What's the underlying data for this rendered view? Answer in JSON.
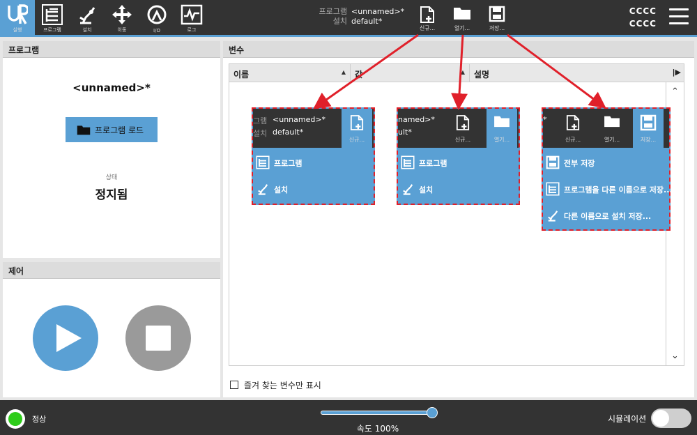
{
  "nav": {
    "run": "실행",
    "program": "프로그램",
    "installation": "설치",
    "move": "이동",
    "io": "I/O",
    "log": "로그"
  },
  "file": {
    "program_key": "프로그램",
    "program_value": "<unnamed>*",
    "installation_key": "설치",
    "installation_value": "default*"
  },
  "toolbar": {
    "new": "신규...",
    "open": "열기...",
    "save": "저장..."
  },
  "robot": {
    "name_line1": "CCCC",
    "name_line2": "CCCC"
  },
  "program_panel": {
    "title": "프로그램",
    "program_name": "<unnamed>*",
    "load_button": "프로그램 로드",
    "status_label": "상태",
    "status_value": "정지됨"
  },
  "control_panel": {
    "title": "제어"
  },
  "variables_panel": {
    "title": "변수",
    "columns": [
      "이름",
      "값",
      "설명"
    ],
    "favorites_checkbox": "즐겨 찾는 변수만 표시"
  },
  "dropdown_new": {
    "partial_key1": "그램",
    "partial_key2": "설치",
    "value1": "<unnamed>*",
    "value2": "default*",
    "new": "신규...",
    "items": [
      "프로그램",
      "설치"
    ]
  },
  "dropdown_open": {
    "value1": "named>*",
    "value2": "ult*",
    "new": "신규...",
    "open": "열기...",
    "items": [
      "프로그램",
      "설치"
    ]
  },
  "dropdown_save": {
    "star": "*",
    "new": "신규...",
    "open": "열기...",
    "save": "저장...",
    "items": [
      "전부 저장",
      "프로그램을 다른 이름으로 저장...",
      "다른 이름으로 설치 저장..."
    ]
  },
  "bottom": {
    "status": "정상",
    "speed": "속도 100%",
    "speed_value": 1.0,
    "simulation": "시뮬레이션"
  },
  "colors": {
    "accent": "#5aa0d4",
    "dark": "#333333",
    "annotation": "#e0202a",
    "status_ok": "#2ecc1a"
  }
}
